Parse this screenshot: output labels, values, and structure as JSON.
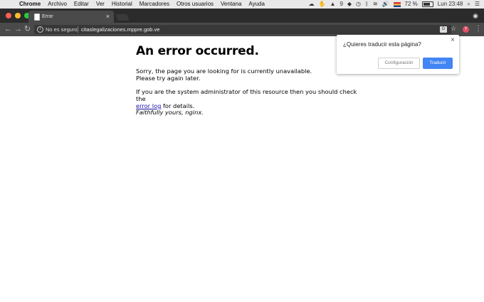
{
  "menubar": {
    "items": [
      "Chrome",
      "Archivo",
      "Editar",
      "Ver",
      "Historial",
      "Marcadores",
      "Otros usuarios",
      "Ventana",
      "Ayuda"
    ],
    "status_number": "9",
    "battery": "72 %",
    "clock": "Lun 23:48"
  },
  "tab": {
    "title": "Error"
  },
  "toolbar": {
    "security_label": "No es seguro",
    "url": "citaslegalizaciones.mppre.gob.ve",
    "profile_initial": "Y"
  },
  "page": {
    "heading": "An error occurred.",
    "p1a": "Sorry, the page you are looking for is currently unavailable.",
    "p1b": "Please try again later.",
    "p2a": "If you are the system administrator of this resource then you should check the",
    "p2_link": "error log",
    "p2b": " for details.",
    "p3": "Faithfully yours, nginx."
  },
  "translate": {
    "question": "¿Quieres traducir esta página?",
    "settings_label": "Configuración",
    "translate_label": "Traducir"
  },
  "colors": {
    "accent": "#4285f4",
    "link": "#1a0dab"
  }
}
